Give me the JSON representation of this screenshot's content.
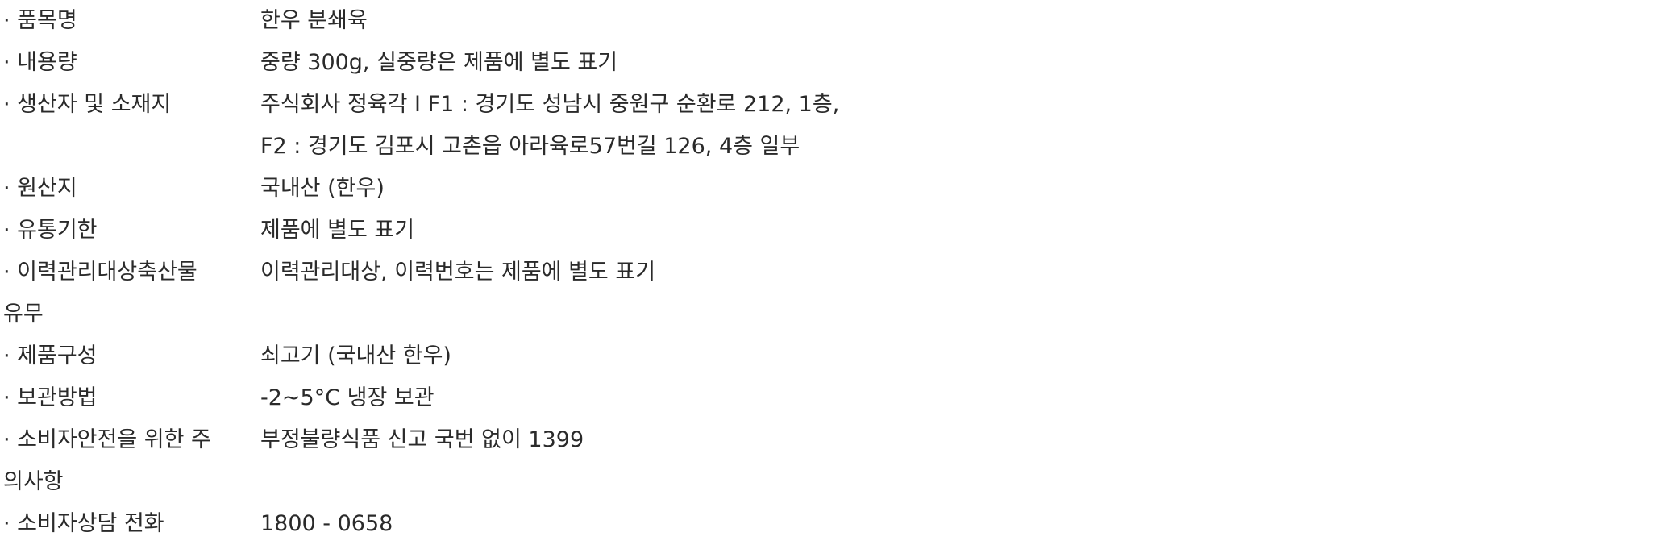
{
  "rows": [
    {
      "label": "· 품목명",
      "value": "한우 분쇄육"
    },
    {
      "label": "· 내용량",
      "value": "중량 300g, 실중량은 제품에 별도 표기"
    },
    {
      "label": "· 생산자 및 소재지",
      "value": "주식회사 정육각 I F1 : 경기도 성남시 중원구 순환로 212, 1층,"
    },
    {
      "label": "",
      "value": "F2 : 경기도 김포시 고촌읍 아라육로57번길 126, 4층 일부"
    },
    {
      "label": "· 원산지",
      "value": "국내산 (한우)"
    },
    {
      "label": "· 유통기한",
      "value": "제품에 별도 표기"
    },
    {
      "label": "· 이력관리대상축산물",
      "value": "이력관리대상, 이력번호는 제품에 별도 표기"
    },
    {
      "label": "유무",
      "value": ""
    },
    {
      "label": "· 제품구성",
      "value": "쇠고기 (국내산 한우)"
    },
    {
      "label": "· 보관방법",
      "value": "-2~5°C 냉장 보관"
    },
    {
      "label": "· 소비자안전을 위한 주",
      "value": "부정불량식품 신고 국번 없이 1399"
    },
    {
      "label": "의사항",
      "value": ""
    },
    {
      "label": "· 소비자상담 전화",
      "value": "1800 - 0658"
    }
  ]
}
